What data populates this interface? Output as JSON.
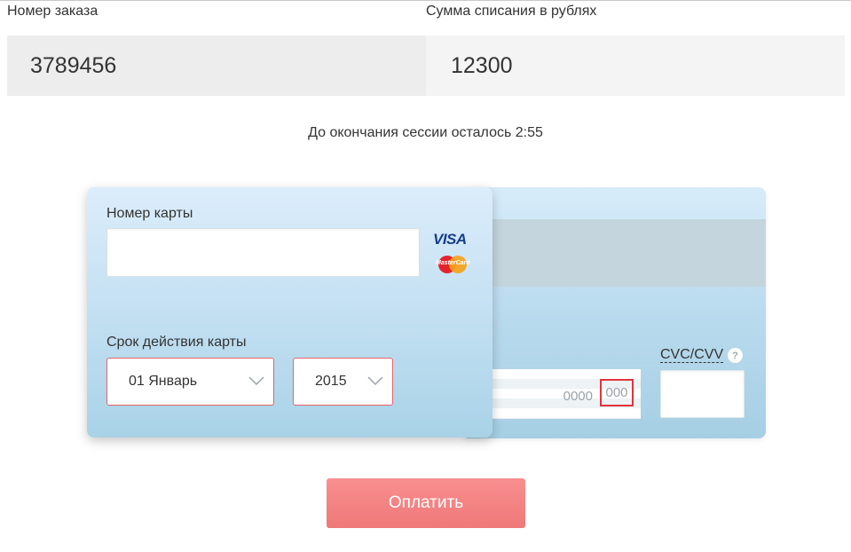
{
  "order": {
    "label": "Номер заказа",
    "value": "3789456"
  },
  "amount": {
    "label": "Сумма списания в рублях",
    "value": "12300"
  },
  "session": {
    "label": "До окончания сессии осталось",
    "time": "2:55"
  },
  "card_front": {
    "number_label": "Номер карты",
    "number_value": "",
    "expiry_label": "Срок действия карты",
    "month_selected": "01 Январь",
    "year_selected": "2015",
    "brands": {
      "visa": "VISA",
      "mastercard": "MasterCard"
    }
  },
  "card_back": {
    "cvc_label": "CVC/CVV",
    "help": "?",
    "cvc_value": "",
    "sample_number": "0000",
    "sample_cvc": "000"
  },
  "pay_button": {
    "label": "Оплатить"
  },
  "colors": {
    "accent": "#f38585",
    "error_border": "#e2646a",
    "card_light": "#dcedfb",
    "card_dark": "#a9d2e7"
  }
}
